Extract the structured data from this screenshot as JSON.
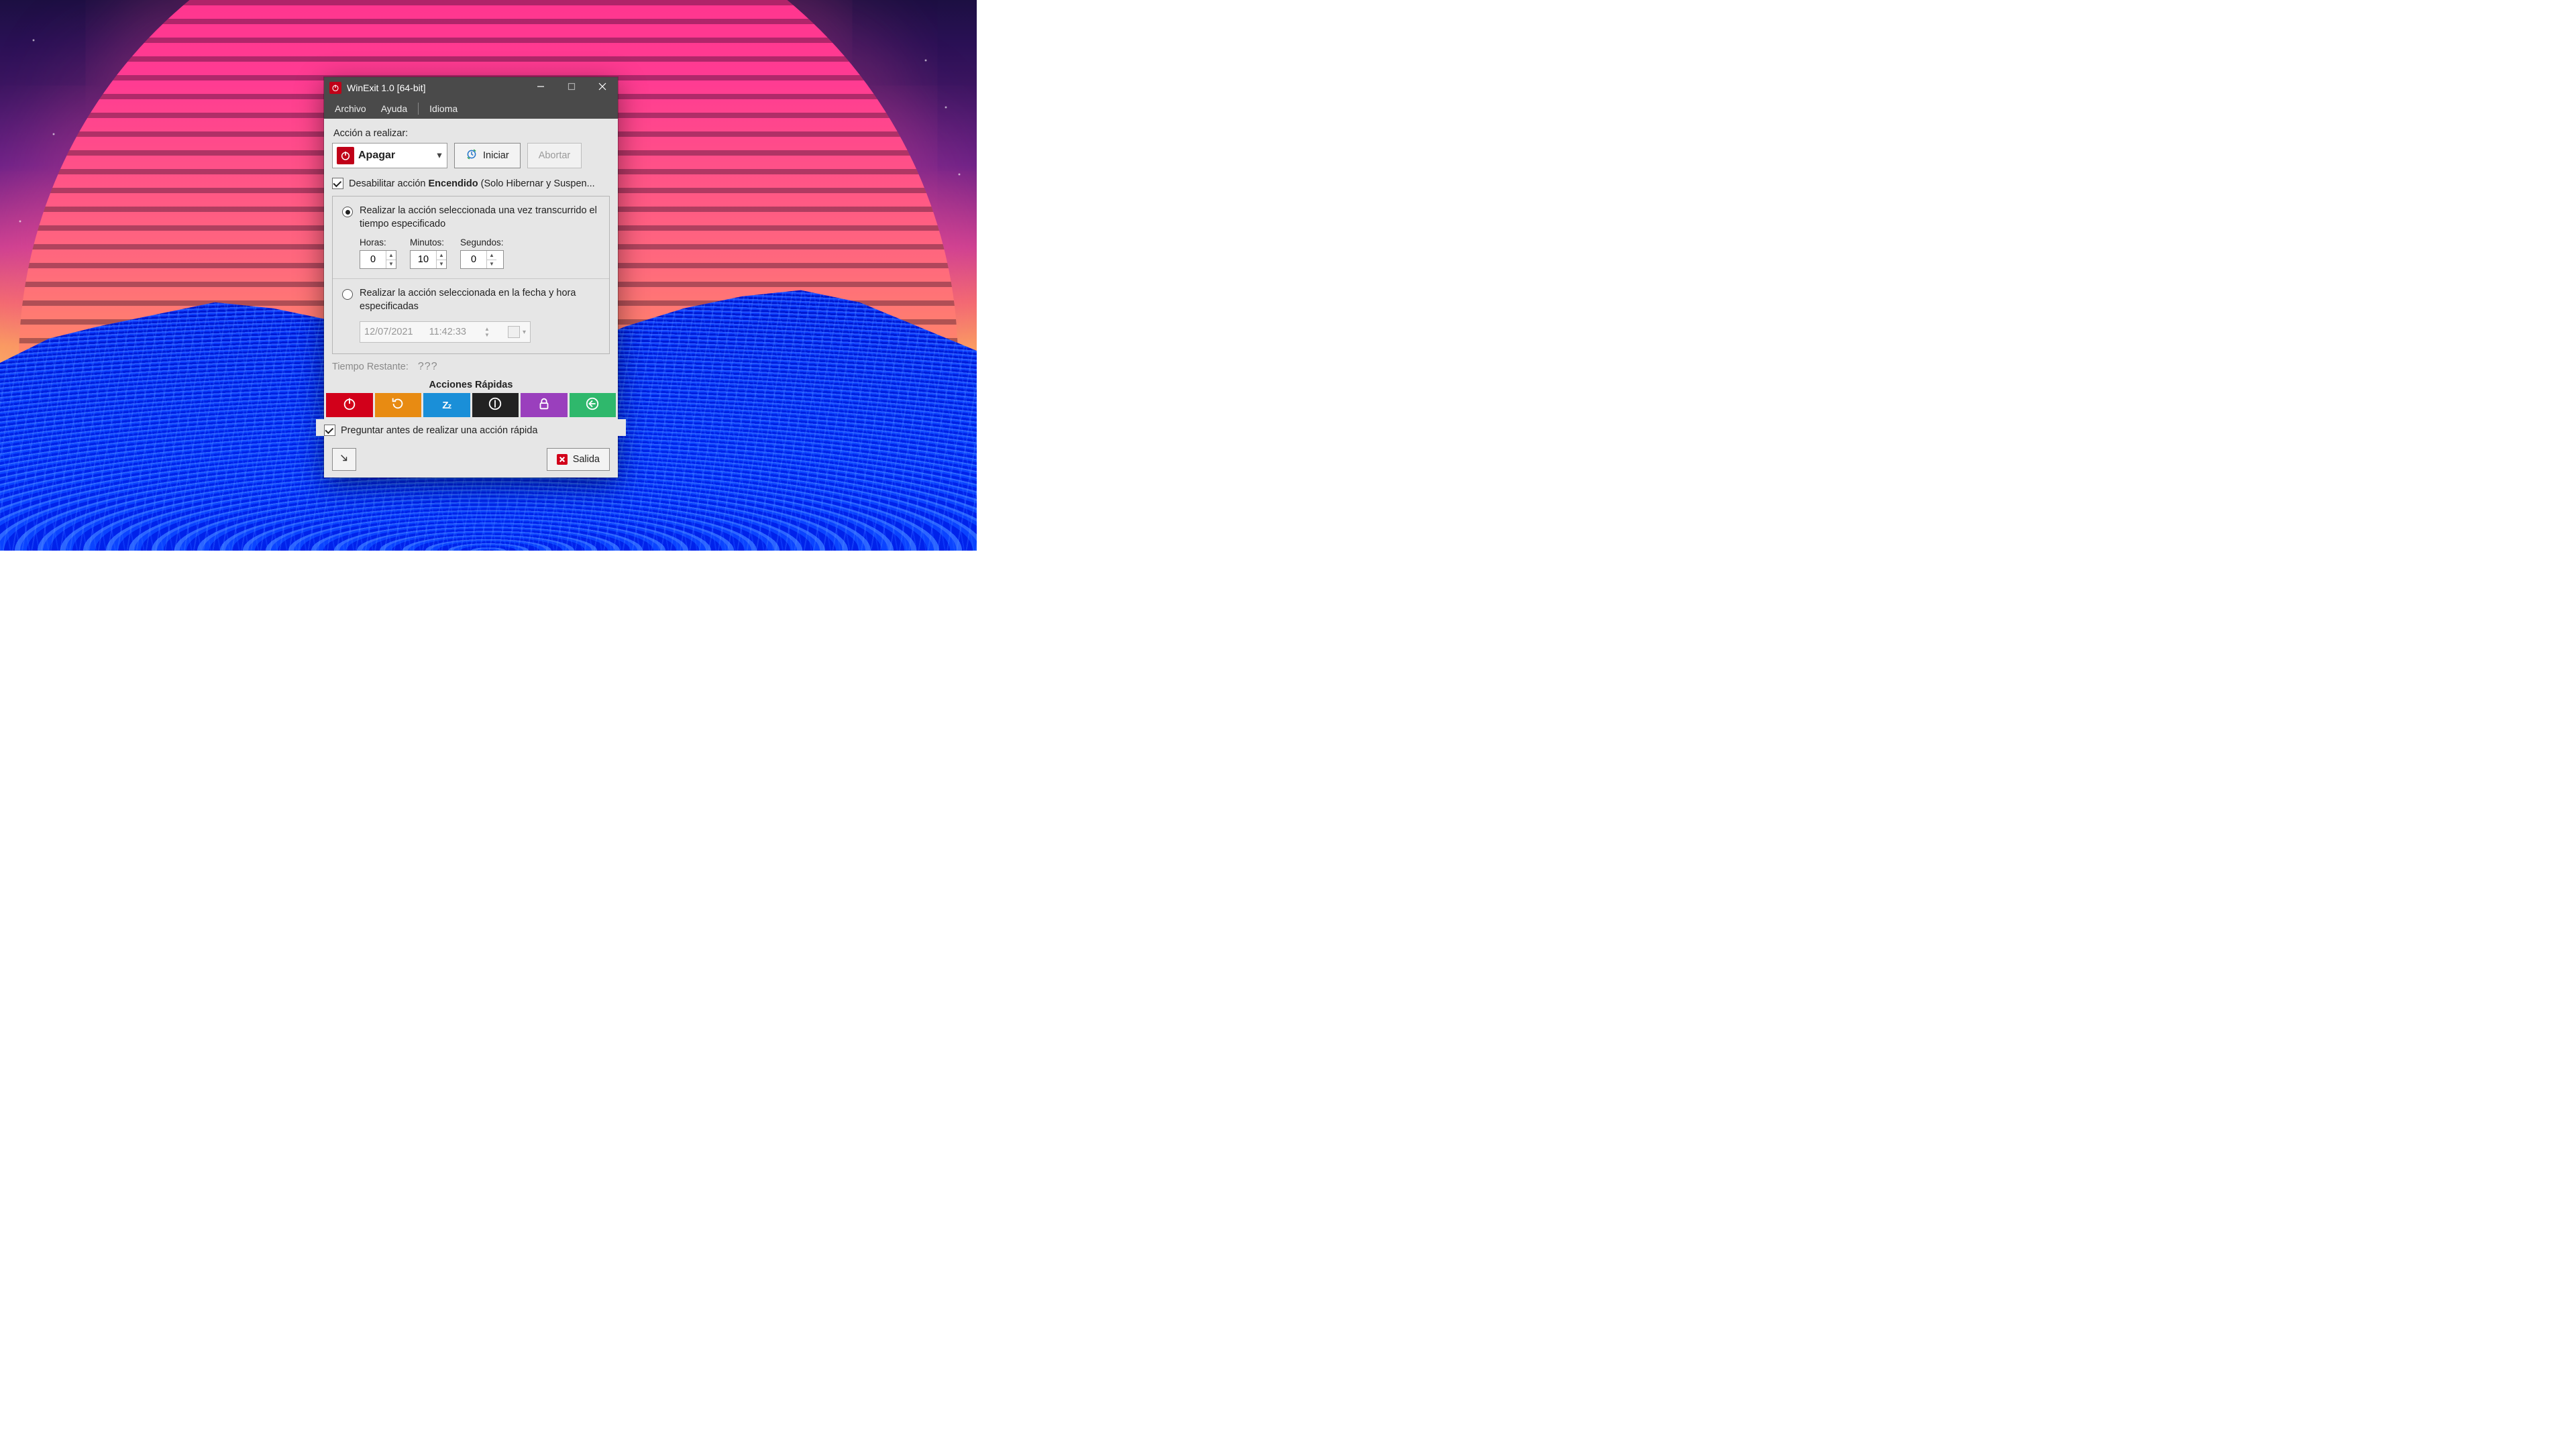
{
  "window": {
    "title": "WinExit 1.0  [64-bit]"
  },
  "menubar": {
    "file": "Archivo",
    "help": "Ayuda",
    "language": "Idioma"
  },
  "action": {
    "label": "Acción a realizar:",
    "selected": "Apagar",
    "start": "Iniciar",
    "abort": "Abortar"
  },
  "disable": {
    "prefix": "Desabilitar acción ",
    "bold": "Encendido",
    "suffix": " (Solo Hibernar y Suspen...",
    "checked": true
  },
  "timer": {
    "radio_elapsed": "Realizar la acción seleccionada una vez transcurrido el tiempo especificado",
    "radio_scheduled": "Realizar la acción seleccionada en la fecha y hora especificadas",
    "labels": {
      "hours": "Horas:",
      "minutes": "Minutos:",
      "seconds": "Segundos:"
    },
    "hours": "0",
    "minutes": "10",
    "seconds": "0",
    "datetime_date": "12/07/2021",
    "datetime_time": "11:42:33",
    "selected": "elapsed"
  },
  "status": {
    "label": "Tiempo Restante:",
    "value": "???"
  },
  "quick": {
    "title": "Acciones Rápidas",
    "ask_label": "Preguntar antes de realizar una acción rápida",
    "ask_checked": true,
    "buttons": {
      "shutdown": "shutdown",
      "restart": "restart",
      "sleep": "sleep",
      "hibernate": "hibernate",
      "lock": "lock",
      "logoff": "logoff"
    }
  },
  "footer": {
    "exit": "Salida"
  }
}
